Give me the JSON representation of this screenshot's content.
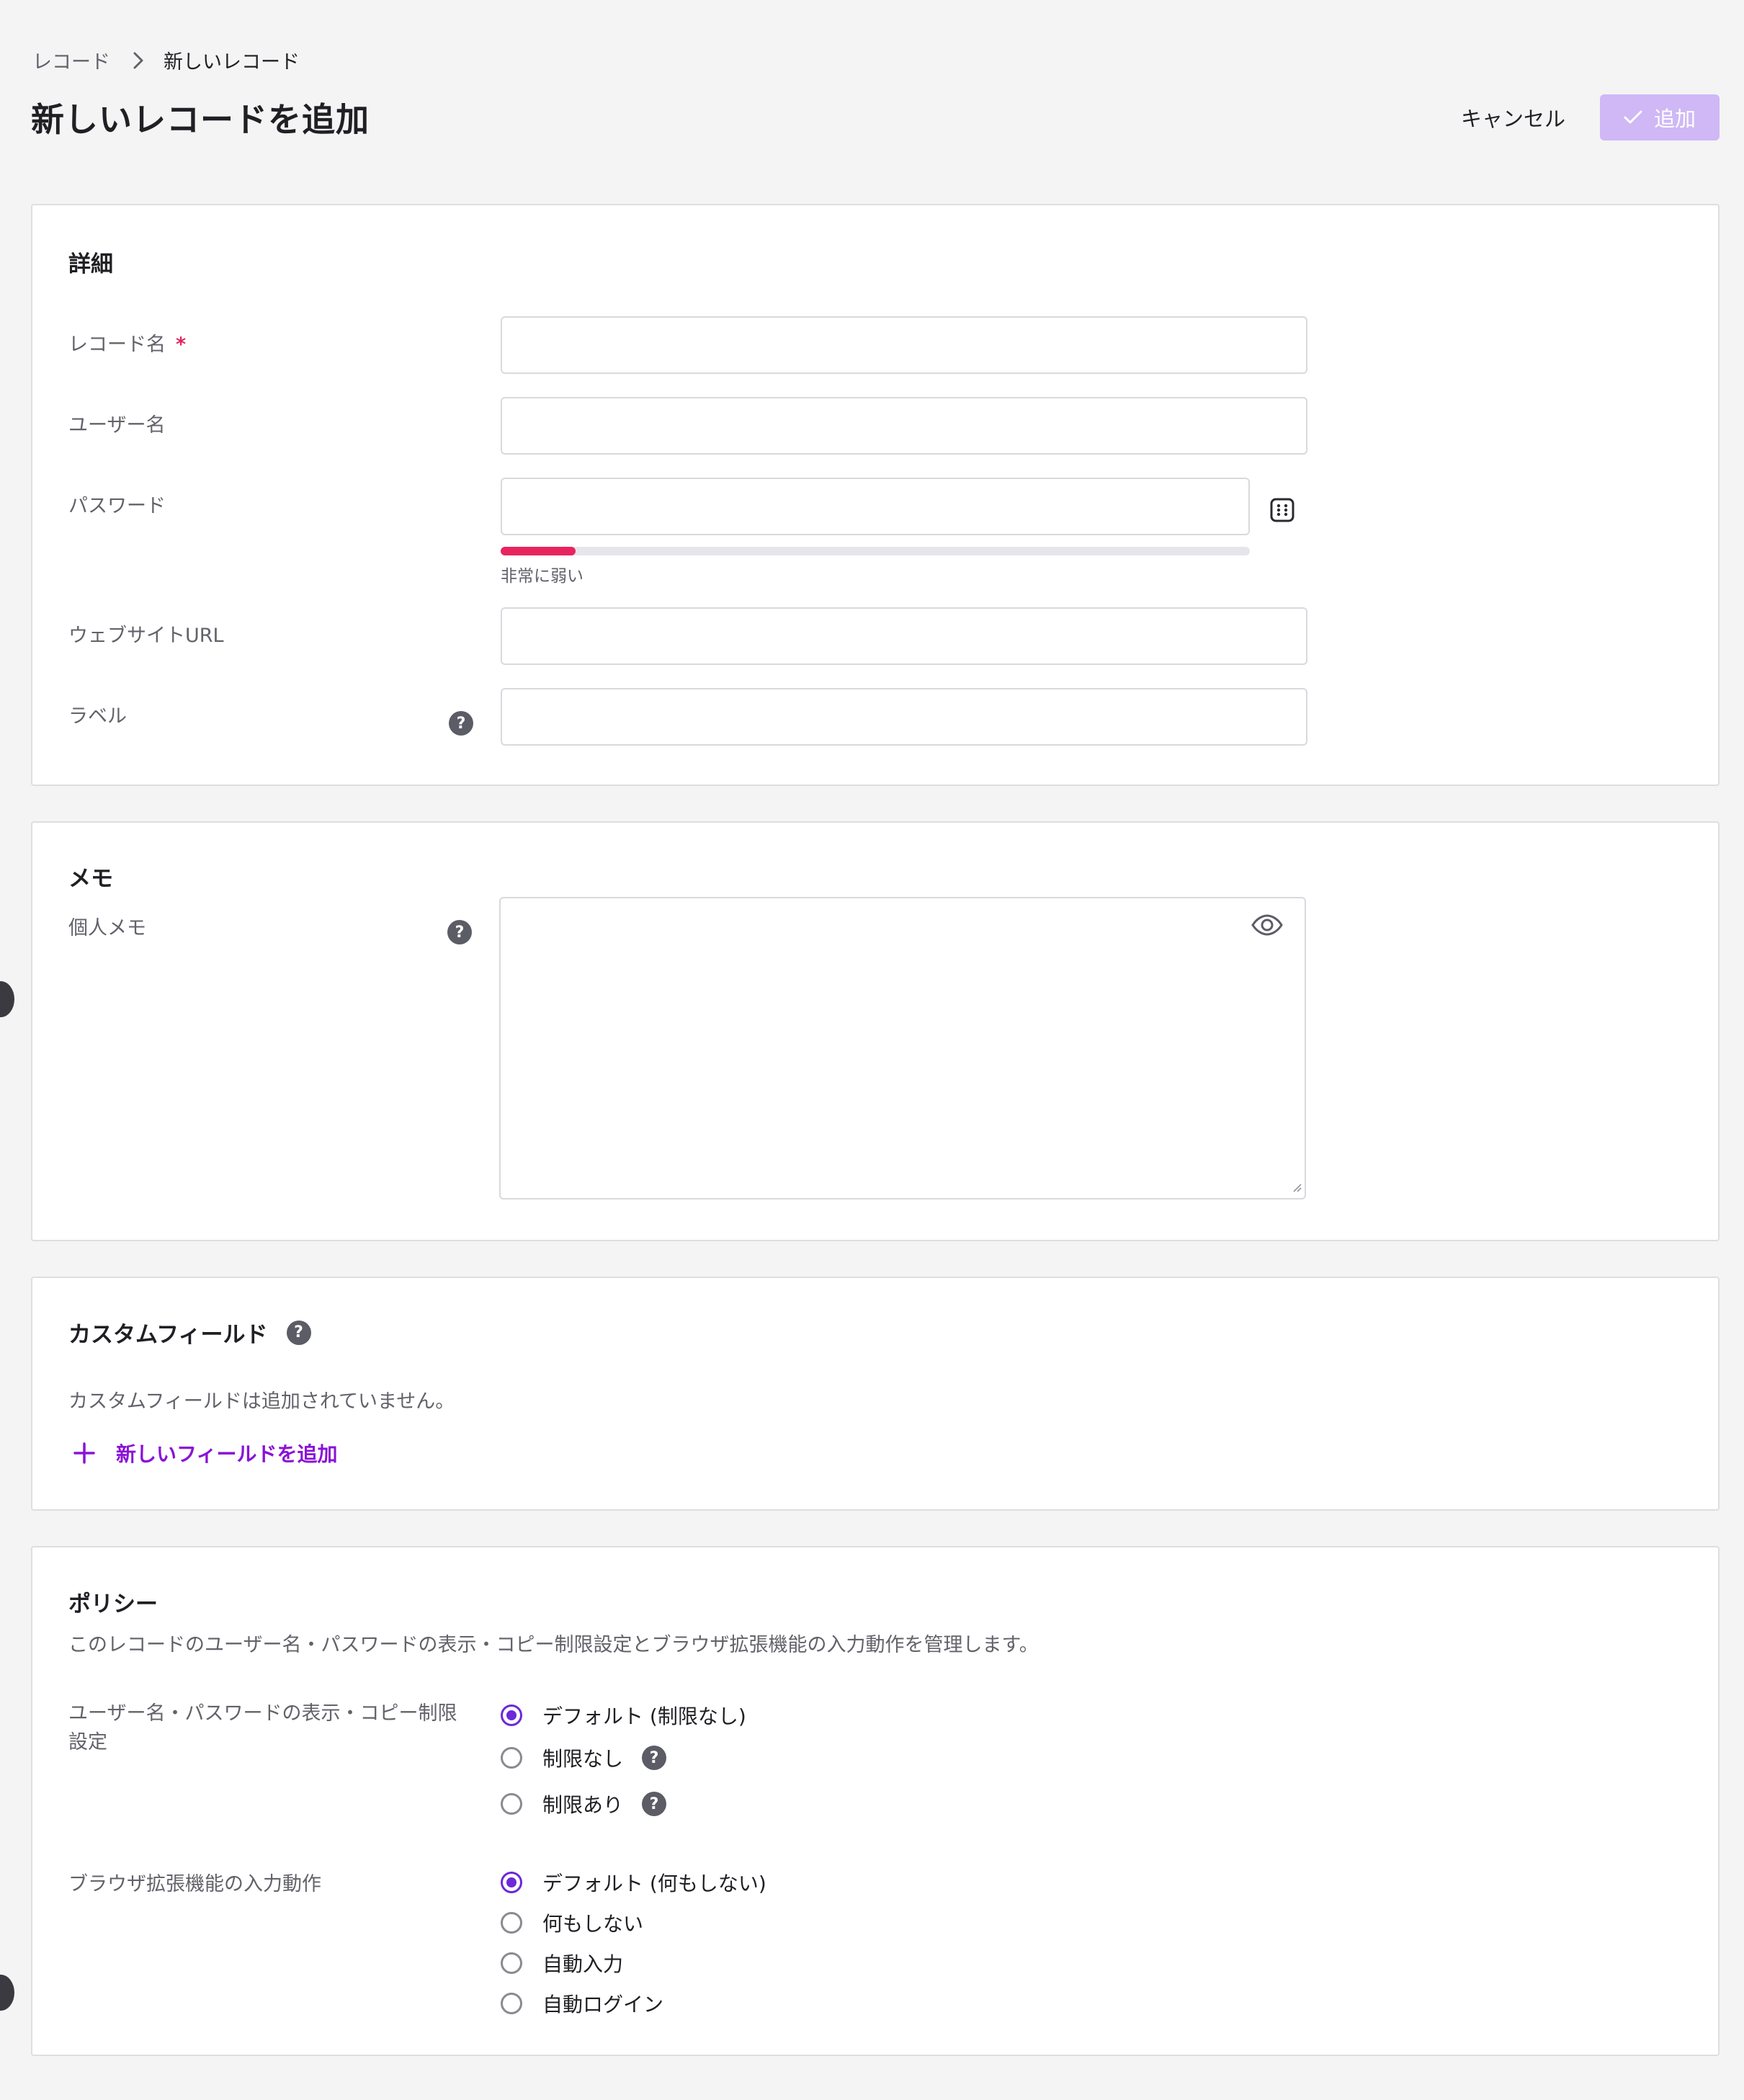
{
  "breadcrumb": {
    "parent": "レコード",
    "current": "新しいレコード"
  },
  "page": {
    "title": "新しいレコードを追加"
  },
  "actions": {
    "cancel": "キャンセル",
    "add": "追加"
  },
  "details": {
    "title": "詳細",
    "record_name_label": "レコード名",
    "required_mark": "*",
    "username_label": "ユーザー名",
    "password_label": "パスワード",
    "password_strength": {
      "text": "非常に弱い",
      "level": 0.1,
      "color": "#e8245e"
    },
    "website_label": "ウェブサイトURL",
    "labels_label": "ラベル"
  },
  "memo": {
    "title": "メモ",
    "personal_label": "個人メモ"
  },
  "custom_fields": {
    "title": "カスタムフィールド",
    "empty_text": "カスタムフィールドは追加されていません。",
    "add_label": "新しいフィールドを追加"
  },
  "policy": {
    "title": "ポリシー",
    "description": "このレコードのユーザー名・パスワードの表示・コピー制限設定とブラウザ拡張機能の入力動作を管理します。",
    "display_label_line1": "ユーザー名・パスワードの表示・コピー制限",
    "display_label_line2": "設定",
    "display_options": [
      "デフォルト (制限なし)",
      "制限なし",
      "制限あり"
    ],
    "display_selected": 0,
    "browser_label": "ブラウザ拡張機能の入力動作",
    "browser_options": [
      "デフォルト (何もしない)",
      "何もしない",
      "自動入力",
      "自動ログイン"
    ],
    "browser_selected": 0
  },
  "colors": {
    "accent": "#6d28d9",
    "link": "#8a12d6",
    "add_button_disabled": "#cfb8f5",
    "danger": "#e8245e"
  }
}
